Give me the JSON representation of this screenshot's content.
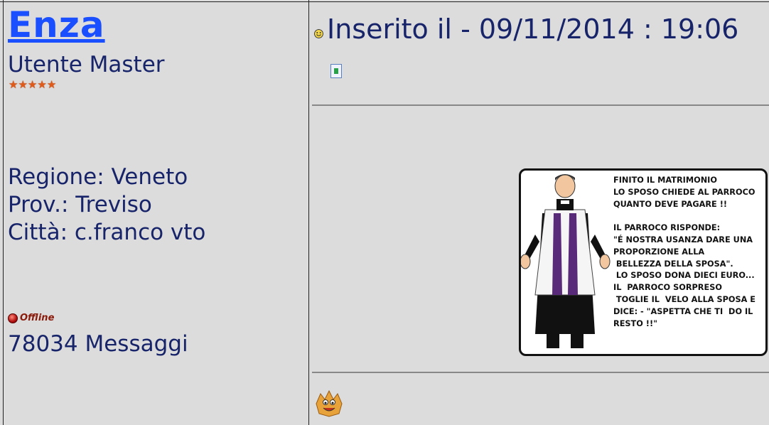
{
  "user": {
    "name": "Enza",
    "rank": "Utente Master",
    "stars": [
      "★",
      "★",
      "★",
      "★",
      "★"
    ],
    "region": "Regione: Veneto",
    "province": "Prov.: Treviso",
    "city": "Città: c.franco vto",
    "status": "Offline",
    "messages": "78034 Messaggi"
  },
  "post": {
    "header": "Inserito il - 09/11/2014 : 19:06",
    "icon": "smiley-icon",
    "image_text": [
      "FINITO IL MATRIMONIO",
      "LO SPOSO CHIEDE AL PARROCO",
      "QUANTO DEVE PAGARE !!",
      "",
      "IL PARROCO RISPONDE:",
      "\"É NOSTRA USANZA DARE UNA",
      "PROPORZIONE ALLA",
      " BELLEZZA DELLA SPOSA\".",
      " LO SPOSO DONA DIECI EURO...",
      "IL  PARROCO SORPRESO",
      " TOGLIE IL  VELO ALLA SPOSA E",
      "DICE: - \"ASPETTA CHE TI  DO IL",
      "RESTO !!\""
    ]
  },
  "colors": {
    "background": "#dcdcdc",
    "text": "#17246a",
    "link": "#1a4fff",
    "offline": "#8a1a0a"
  }
}
